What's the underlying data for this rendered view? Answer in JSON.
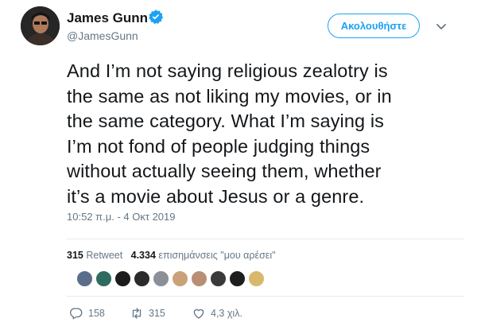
{
  "tweet": {
    "author_name": "James Gunn",
    "handle": "@JamesGunn",
    "follow_label": "Ακολουθήστε",
    "text_lines": [
      "And I’m not saying religious zealotry is",
      "the same as not liking my movies, or in",
      "the same category. What I’m saying is",
      "I’m not fond of people judging things",
      "without actually seeing them, whether",
      "it’s a movie about Jesus or a genre."
    ],
    "timestamp": "10:52 π.μ. - 4 Οκτ 2019"
  },
  "stats": {
    "retweet_count": "315",
    "retweet_label": "Retweet",
    "like_count": "4.334",
    "like_label": "επισημάνσεις \"μου αρέσει\""
  },
  "liker_avatars": [
    {
      "color": "#5a6e8c"
    },
    {
      "color": "#2f6b5e"
    },
    {
      "color": "#1c1c1c"
    },
    {
      "color": "#2b2b2b"
    },
    {
      "color": "#8a8f98"
    },
    {
      "color": "#c9a27a"
    },
    {
      "color": "#b88f73"
    },
    {
      "color": "#3a3a3a"
    },
    {
      "color": "#1e1e1e"
    },
    {
      "color": "#d8b86a"
    }
  ],
  "actions": {
    "reply_count": "158",
    "retweet_count": "315",
    "like_count": "4,3 χιλ."
  },
  "colors": {
    "accent": "#1da1f2",
    "secondary_text": "#657786",
    "divider": "#e6ecf0"
  }
}
